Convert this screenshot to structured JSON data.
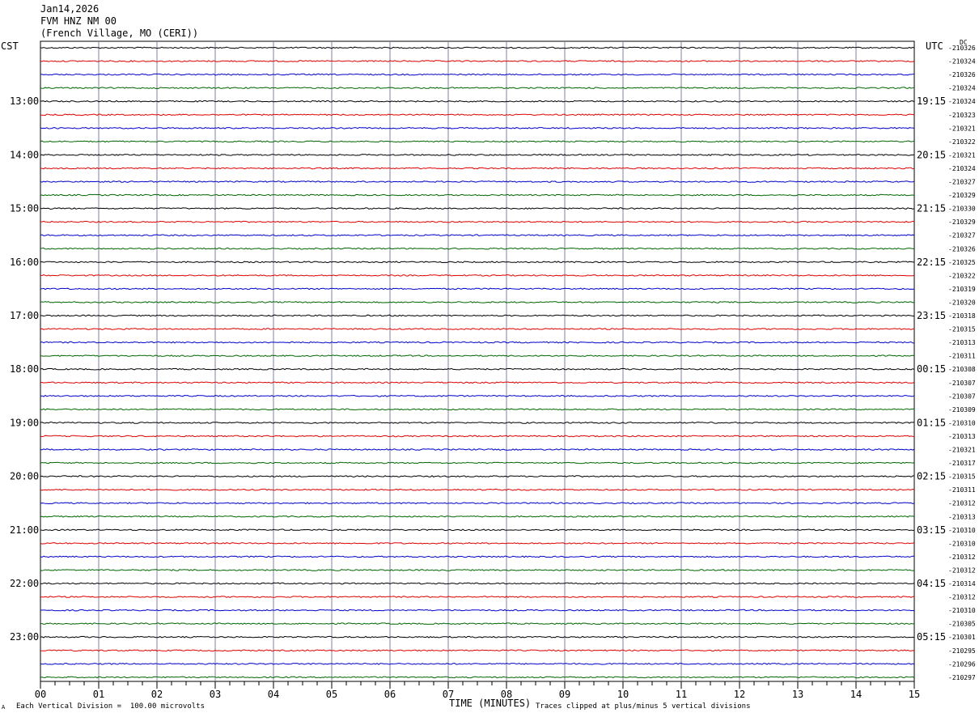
{
  "header": {
    "date": "Jan14,2026",
    "station": "FVM HNZ NM 00",
    "location": "(French Village, MO (CERI))"
  },
  "left_tz_label": "CST",
  "right_tz_label": "UTC",
  "dc_label": "DC",
  "footer": {
    "scale_note": "Each Vertical Division =  100.00 microvolts",
    "clip_note": "Traces clipped at plus/minus 5 vertical divisions",
    "corner_mark": "A"
  },
  "colors": {
    "trace_cycle": [
      "#000000",
      "#e00000",
      "#0000cc",
      "#006600"
    ],
    "grid": "#8080a0"
  },
  "chart_data": {
    "type": "line",
    "title": "Jan14,2026 FVM HNZ NM 00 (French Village, MO (CERI))",
    "xlabel": "TIME (MINUTES)",
    "x_ticks": [
      "00",
      "01",
      "02",
      "03",
      "04",
      "05",
      "06",
      "07",
      "08",
      "09",
      "10",
      "11",
      "12",
      "13",
      "14",
      "15"
    ],
    "xlim": [
      0,
      15
    ],
    "left_hour_labels": [
      "13:00",
      "14:00",
      "15:00",
      "16:00",
      "17:00",
      "18:00",
      "19:00",
      "20:00",
      "21:00",
      "22:00",
      "23:00"
    ],
    "right_hour_labels": [
      "19:15",
      "20:15",
      "21:15",
      "22:15",
      "23:15",
      "00:15",
      "01:15",
      "02:15",
      "03:15",
      "04:15",
      "05:15"
    ],
    "dc_offsets": [
      "-210326",
      "-210324",
      "-210326",
      "-210324",
      "-210324",
      "-210323",
      "-210321",
      "-210322",
      "-210321",
      "-210324",
      "-210327",
      "-210329",
      "-210330",
      "-210329",
      "-210327",
      "-210326",
      "-210325",
      "-210322",
      "-210319",
      "-210320",
      "-210318",
      "-210315",
      "-210313",
      "-210311",
      "-210308",
      "-210307",
      "-210307",
      "-210309",
      "-210310",
      "-210313",
      "-210321",
      "-210317",
      "-210315",
      "-210311",
      "-210312",
      "-210313",
      "-210310",
      "-210310",
      "-210312",
      "-210312",
      "-210314",
      "-210312",
      "-210310",
      "-210305",
      "-210301",
      "-210295",
      "-210296",
      "-210297"
    ],
    "traces_per_hour": 4,
    "minutes_per_trace": 15
  }
}
